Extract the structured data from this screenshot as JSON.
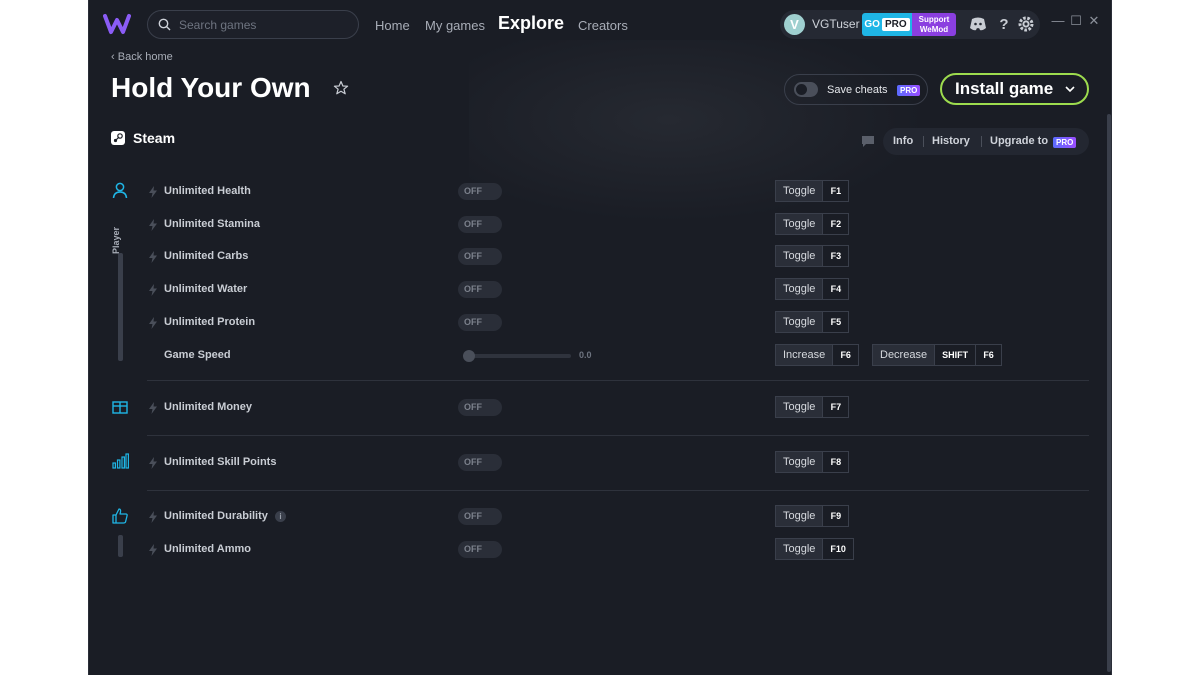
{
  "app": {
    "nav": {
      "home": "Home",
      "my_games": "My games",
      "explore": "Explore",
      "creators": "Creators"
    },
    "search_placeholder": "Search games",
    "user": {
      "avatar_initial": "V",
      "name": "VGTuser",
      "go_pro_prefix": "GO",
      "go_pro_badge": "PRO",
      "support_line1": "Support",
      "support_line2": "WeMod"
    },
    "window_controls": {
      "minimize": "—",
      "maximize": "☐",
      "close": "✕"
    }
  },
  "header": {
    "back_label": "Back home",
    "game_title": "Hold Your Own",
    "save_cheats_label": "Save cheats",
    "pro_label": "PRO",
    "install_label": "Install game",
    "platform": "Steam",
    "tabs": {
      "info": "Info",
      "history": "History",
      "upgrade": "Upgrade to",
      "pro": "PRO"
    }
  },
  "categories": {
    "player": "Player"
  },
  "cheats": {
    "off": "OFF",
    "toggle": "Toggle",
    "health": {
      "name": "Unlimited Health",
      "key": "F1"
    },
    "stamina": {
      "name": "Unlimited Stamina",
      "key": "F2"
    },
    "carbs": {
      "name": "Unlimited Carbs",
      "key": "F3"
    },
    "water": {
      "name": "Unlimited Water",
      "key": "F4"
    },
    "protein": {
      "name": "Unlimited Protein",
      "key": "F5"
    },
    "speed": {
      "name": "Game Speed",
      "value": "0.0",
      "level": 0.0,
      "increase": "Increase",
      "increase_key": "F6",
      "decrease": "Decrease",
      "decrease_mod": "SHIFT",
      "decrease_key": "F6"
    },
    "money": {
      "name": "Unlimited Money",
      "key": "F7"
    },
    "skill": {
      "name": "Unlimited Skill Points",
      "key": "F8"
    },
    "durability": {
      "name": "Unlimited Durability",
      "key": "F9",
      "info": "i"
    },
    "ammo": {
      "name": "Unlimited Ammo",
      "key": "F10"
    }
  },
  "colors": {
    "background": "#1a1d25",
    "install_border": "#9ddc4e",
    "go_pro": "#1fb6e6",
    "support": "#8b3fe0",
    "player_icon": "#1fb6e6"
  }
}
